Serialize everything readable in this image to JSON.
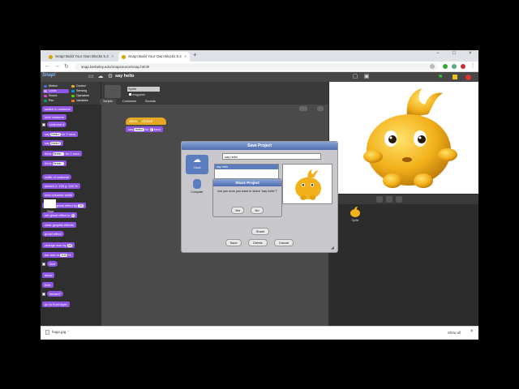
{
  "browser": {
    "tabs": [
      {
        "title": "Snap! Build Your Own Blocks 5.4",
        "active": false
      },
      {
        "title": "Snap! Build Your Own Blocks 5.4",
        "active": true
      }
    ],
    "new_tab": "+",
    "window_controls": {
      "minimize": "−",
      "maximize": "□",
      "close": "×"
    },
    "nav": {
      "back": "←",
      "forward": "→",
      "reload": "↻"
    },
    "url": "snap.berkeley.edu/snapsource/snap.html#",
    "download": {
      "file": "hugo.jpg",
      "show_all": "Show all",
      "close": "×"
    }
  },
  "snap": {
    "logo": "Snap!",
    "project_name": "say hello",
    "categories": [
      {
        "label": "Motion",
        "color": "#4a6cd4"
      },
      {
        "label": "Looks",
        "color": "#8f56e3"
      },
      {
        "label": "Sound",
        "color": "#cf4ad9"
      },
      {
        "label": "Pen",
        "color": "#0e9a6c"
      },
      {
        "label": "Control",
        "color": "#e6a822"
      },
      {
        "label": "Sensing",
        "color": "#0494dc"
      },
      {
        "label": "Operators",
        "color": "#62c213"
      },
      {
        "label": "Variables",
        "color": "#f3761d"
      }
    ],
    "sprite_name": "Sprite",
    "draggable_label": "draggable",
    "sprite_tabs": [
      "Scripts",
      "Costumes",
      "Sounds"
    ],
    "palette_blocks": [
      {
        "text": "switch to costume",
        "slot": ""
      },
      {
        "text": "next costume",
        "slot": ""
      },
      {
        "text": "costume #",
        "slot": ""
      },
      {
        "text": "say",
        "slot": "Hello!",
        "suffix": "for 2 secs"
      },
      {
        "text": "say",
        "slot": "Hello!",
        "suffix": ""
      },
      {
        "text": "think",
        "slot": "Hmm...",
        "suffix": "for 2 secs"
      },
      {
        "text": "think",
        "slot": "Hmm...",
        "suffix": ""
      },
      {
        "text": "width of costume",
        "slot": ""
      },
      {
        "text": "stretch",
        "slot": "100",
        "suffix": "x: 100 y: 100 %"
      },
      {
        "text": "new costume",
        "slot": "",
        "suffix": "width"
      },
      {
        "text": "change ghost effect by",
        "slot": "25"
      },
      {
        "text": "set ghost effect to",
        "slot": "0"
      },
      {
        "text": "clear graphic effects",
        "slot": ""
      },
      {
        "text": "ghost effect",
        "slot": ""
      },
      {
        "text": "change size by",
        "slot": "10"
      },
      {
        "text": "set size to",
        "slot": "100",
        "suffix": "%"
      },
      {
        "text": "size",
        "slot": ""
      },
      {
        "text": "show",
        "slot": ""
      },
      {
        "text": "hide",
        "slot": ""
      },
      {
        "text": "shown?",
        "slot": ""
      },
      {
        "text": "go to front layer",
        "slot": ""
      }
    ],
    "script": {
      "hat": {
        "prefix": "when",
        "suffix": "clicked"
      },
      "say": {
        "text": "say",
        "slot": "Hello!",
        "for": "for",
        "secs_value": "2",
        "secs": "secs"
      }
    },
    "corral": {
      "sprite_label": "Sprite",
      "stage_label": "Stage"
    }
  },
  "save_dialog": {
    "title": "Save Project",
    "sources": [
      {
        "label": "Cloud",
        "selected": true
      },
      {
        "label": "Computer",
        "selected": false
      }
    ],
    "name_value": "say hello",
    "list_items": [
      "say hello"
    ],
    "buttons": {
      "share": "Share",
      "save": "Save",
      "delete": "Delete",
      "cancel": "Cancel"
    }
  },
  "confirm_dialog": {
    "title": "Share Project",
    "message": "Are you sure you want to share \"say hello\"?",
    "yes": "Yes",
    "no": "No"
  }
}
